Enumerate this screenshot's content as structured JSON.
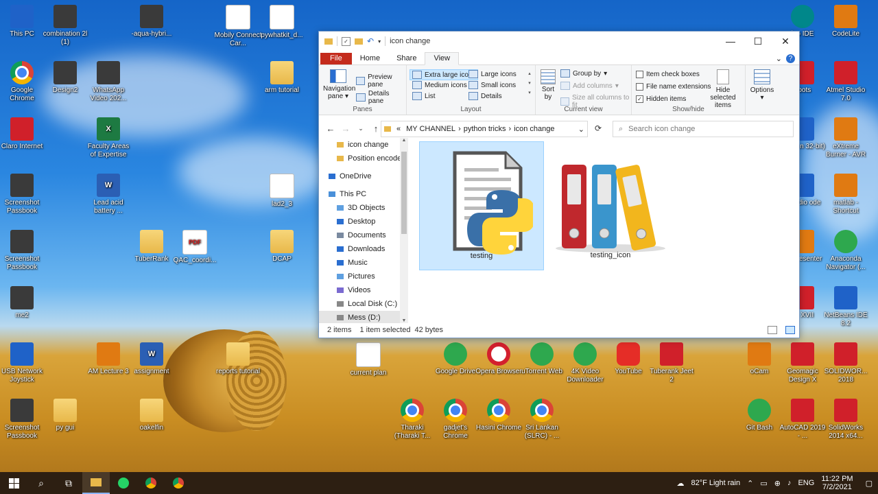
{
  "desktop": {
    "icons": [
      {
        "label": "This PC",
        "kind": "blue"
      },
      {
        "label": "combination 2l (1)",
        "kind": "appsq"
      },
      {
        "label": "-aqua-hybri...",
        "kind": "appsq"
      },
      {
        "label": "Mobily Connect Car...",
        "kind": "file"
      },
      {
        "label": "pywhatkit_d...",
        "kind": "file"
      },
      {
        "label": "Google Chrome",
        "kind": "chrome"
      },
      {
        "label": "Design2",
        "kind": "appsq"
      },
      {
        "label": "WhatsApp Video 202...",
        "kind": "appsq"
      },
      {
        "label": "arm tutorial",
        "kind": "folder"
      },
      {
        "label": "Claro Internet",
        "kind": "red"
      },
      {
        "label": "Faculty Areas of Expertise",
        "kind": "excel"
      },
      {
        "label": "Screenshot Passbook",
        "kind": "appsq"
      },
      {
        "label": "Lead acid battery ...",
        "kind": "word"
      },
      {
        "label": "lad2_3",
        "kind": "file"
      },
      {
        "label": "Screenshot Passbook",
        "kind": "appsq"
      },
      {
        "label": "TuberRank",
        "kind": "folder"
      },
      {
        "label": "QAC_coordi...",
        "kind": "pdf"
      },
      {
        "label": "DCAP",
        "kind": "folder"
      },
      {
        "label": "me2",
        "kind": "appsq"
      },
      {
        "label": "USB Network Joystick",
        "kind": "blue"
      },
      {
        "label": "AM Lecture 3",
        "kind": "orange"
      },
      {
        "label": "assignment",
        "kind": "word"
      },
      {
        "label": "reports tutorial",
        "kind": "folder"
      },
      {
        "label": "current plan",
        "kind": "file"
      },
      {
        "label": "Screenshot Passbook",
        "kind": "appsq"
      },
      {
        "label": "py gui",
        "kind": "folder"
      },
      {
        "label": "oakelfin",
        "kind": "folder"
      },
      {
        "label": "Google Drive",
        "kind": "green"
      },
      {
        "label": "Opera Browser",
        "kind": "opera"
      },
      {
        "label": "uTorrent Web",
        "kind": "green"
      },
      {
        "label": "4K Video Downloader",
        "kind": "green"
      },
      {
        "label": "YouTube",
        "kind": "yt"
      },
      {
        "label": "Tuberank Jeet 2",
        "kind": "red"
      },
      {
        "label": "Tharaki (Tharaki T...",
        "kind": "chrome"
      },
      {
        "label": "gadjet's Chrome",
        "kind": "chrome"
      },
      {
        "label": "Hasini Chrome",
        "kind": "chrome"
      },
      {
        "label": "Sri Lankan (SLRC) - ...",
        "kind": "chrome"
      },
      {
        "label": "ino IDE",
        "kind": "teal"
      },
      {
        "label": "CodeLite",
        "kind": "orange"
      },
      {
        "label": "ebots",
        "kind": "red"
      },
      {
        "label": "Atmel Studio 7.0",
        "kind": "red"
      },
      {
        "label": "(Python 32-bit)",
        "kind": "blue"
      },
      {
        "label": "eXtreme Burner - AVR",
        "kind": "orange"
      },
      {
        "label": "l Studio ode",
        "kind": "blue"
      },
      {
        "label": "matlab - Shortcut",
        "kind": "orange"
      },
      {
        "label": "ctive esenter",
        "kind": "orange"
      },
      {
        "label": "Anaconda Navigator (...",
        "kind": "green"
      },
      {
        "label": "ce XVII",
        "kind": "red"
      },
      {
        "label": "NetBeans IDE 8.2",
        "kind": "blue"
      },
      {
        "label": "oCam",
        "kind": "orange"
      },
      {
        "label": "Geomagic Design X",
        "kind": "red"
      },
      {
        "label": "SOLIDWOR... 2018",
        "kind": "red"
      },
      {
        "label": "Git Bash",
        "kind": "green"
      },
      {
        "label": "AutoCAD 2019 - ...",
        "kind": "red"
      },
      {
        "label": "SolidWorks 2014 x64...",
        "kind": "red"
      }
    ]
  },
  "explorer": {
    "title": "icon change",
    "tabs": {
      "file": "File",
      "home": "Home",
      "share": "Share",
      "view": "View"
    },
    "ribbon": {
      "navigation_pane": "Navigation pane",
      "preview_pane": "Preview pane",
      "details_pane": "Details pane",
      "panes_group": "Panes",
      "extra_large_icons": "Extra large icons",
      "large_icons": "Large icons",
      "medium_icons": "Medium icons",
      "small_icons": "Small icons",
      "list": "List",
      "details": "Details",
      "layout_group": "Layout",
      "sort_by": "Sort by",
      "group_by": "Group by",
      "add_columns": "Add columns",
      "size_all_columns": "Size all columns to fit",
      "current_view_group": "Current view",
      "item_check_boxes": "Item check boxes",
      "file_name_extensions": "File name extensions",
      "hidden_items": "Hidden items",
      "hide_selected_items": "Hide selected items",
      "options": "Options",
      "showhide_group": "Show/hide"
    },
    "address": {
      "prefix": "«",
      "crumbs": [
        "MY CHANNEL",
        "python tricks",
        "icon change"
      ]
    },
    "search_placeholder": "Search icon change",
    "sidebar": [
      {
        "label": "icon change",
        "icon": "folder"
      },
      {
        "label": "Position encoder",
        "icon": "folder"
      },
      {
        "label": "OneDrive",
        "icon": "cloud"
      },
      {
        "label": "This PC",
        "icon": "pc"
      },
      {
        "label": "3D Objects",
        "icon": "cube"
      },
      {
        "label": "Desktop",
        "icon": "desktop"
      },
      {
        "label": "Documents",
        "icon": "doc"
      },
      {
        "label": "Downloads",
        "icon": "download"
      },
      {
        "label": "Music",
        "icon": "music"
      },
      {
        "label": "Pictures",
        "icon": "picture"
      },
      {
        "label": "Videos",
        "icon": "video"
      },
      {
        "label": "Local Disk (C:)",
        "icon": "disk"
      },
      {
        "label": "Mess (D:)",
        "icon": "disk"
      }
    ],
    "files": [
      {
        "name": "testing",
        "selected": true
      },
      {
        "name": "testing_icon",
        "selected": false
      }
    ],
    "status": {
      "count": "2 items",
      "selected": "1 item selected",
      "size": "42 bytes"
    }
  },
  "taskbar": {
    "weather": "82°F Light rain",
    "lang": "ENG",
    "time": "11:22 PM",
    "date": "7/2/2021"
  }
}
